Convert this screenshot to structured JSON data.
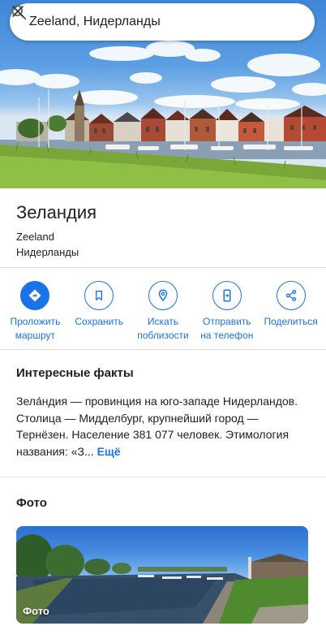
{
  "search": {
    "query": "Zeeland, Нидерланды"
  },
  "place": {
    "title": "Зеландия",
    "subtitle_line1": "Zeeland",
    "subtitle_line2": "Нидерланды"
  },
  "actions": [
    {
      "icon": "directions-icon",
      "label_line1": "Проложить",
      "label_line2": "маршрут"
    },
    {
      "icon": "bookmark-icon",
      "label_line1": "Сохранить",
      "label_line2": ""
    },
    {
      "icon": "nearby-icon",
      "label_line1": "Искать",
      "label_line2": "поблизости"
    },
    {
      "icon": "send-to-phone-icon",
      "label_line1": "Отправить",
      "label_line2": "на телефон"
    },
    {
      "icon": "share-icon",
      "label_line1": "Поделиться",
      "label_line2": ""
    }
  ],
  "facts": {
    "heading": "Интересные факты",
    "text": "Зела́ндия — провинция на юго-западе Нидерландов. Столица — Мидделбург, крупнейший город — Тернёзен. Население 381 077 человек. Этимология названия: «З...",
    "more": "Ещё"
  },
  "photos": {
    "heading": "Фото",
    "caption": "Фото"
  },
  "colors": {
    "accent": "#1a73e8",
    "text": "#202124",
    "divider": "#e0e0e0"
  }
}
